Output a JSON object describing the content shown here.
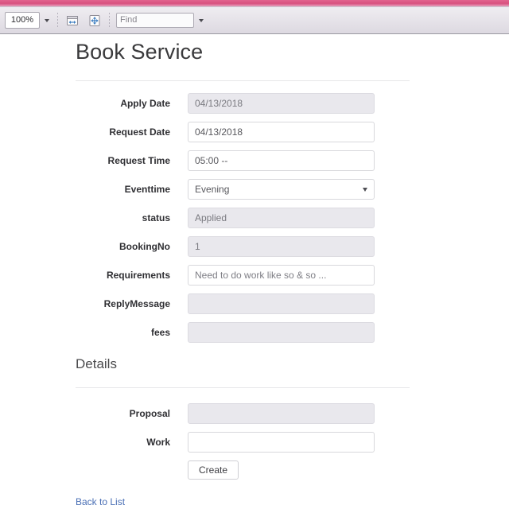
{
  "viewer": {
    "zoom_level": "100%",
    "zoom_dropdown_icon": "chevron-down-icon",
    "fit_width_icon": "fit-width-icon",
    "fit_page_icon": "fit-page-icon",
    "find_placeholder": "Find",
    "find_value": "",
    "find_dropdown_icon": "chevron-down-icon",
    "accent_color": "#d8517f",
    "toolbar_bg": "#e6e3e9"
  },
  "page": {
    "title": "Book Service",
    "section_title": "Details",
    "fields": [
      {
        "label": "Apply Date",
        "value": "04/13/2018",
        "type": "text",
        "disabled": true
      },
      {
        "label": "Request Date",
        "value": "04/13/2018",
        "type": "text",
        "disabled": false
      },
      {
        "label": "Request Time",
        "value": "05:00 --",
        "type": "text",
        "disabled": false
      },
      {
        "label": "Eventtime",
        "value": "Evening",
        "type": "select",
        "disabled": false
      },
      {
        "label": "status",
        "value": "Applied",
        "type": "text",
        "disabled": true
      },
      {
        "label": "BookingNo",
        "value": "1",
        "type": "text",
        "disabled": true
      },
      {
        "label": "Requirements",
        "value": "Need to do work like so & so ...",
        "type": "text",
        "disabled": false
      },
      {
        "label": "ReplyMessage",
        "value": "",
        "type": "text",
        "disabled": true
      },
      {
        "label": "fees",
        "value": "",
        "type": "text",
        "disabled": true
      }
    ],
    "detail_fields": [
      {
        "label": "Proposal",
        "value": "",
        "type": "text",
        "disabled": true
      },
      {
        "label": "Work",
        "value": "",
        "type": "text",
        "disabled": false
      }
    ],
    "submit_label": "Create",
    "back_link_label": "Back to List",
    "link_color": "#4a6fb5"
  }
}
